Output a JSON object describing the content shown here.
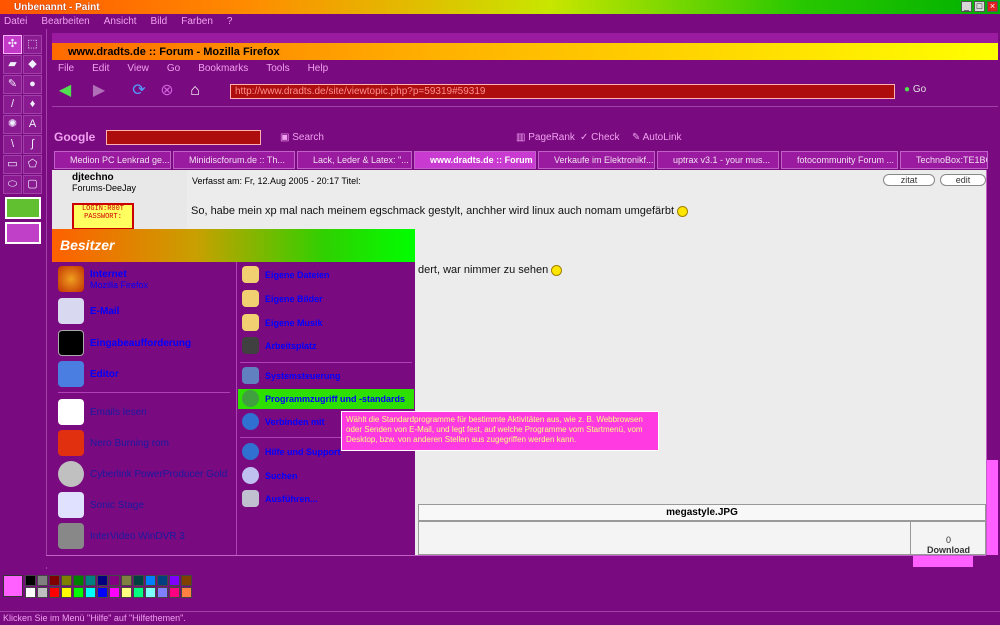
{
  "paint": {
    "title": "Unbenannt - Paint",
    "menu": [
      "Datei",
      "Bearbeiten",
      "Ansicht",
      "Bild",
      "Farben",
      "?"
    ],
    "status": "Klicken Sie im Menü \"Hilfe\" auf \"Hilfethemen\"."
  },
  "firefox": {
    "title": "www.dradts.de :: Forum - Mozilla Firefox",
    "menu": [
      "File",
      "Edit",
      "View",
      "Go",
      "Bookmarks",
      "Tools",
      "Help"
    ],
    "url": "http://www.dradts.de/site/viewtopic.php?p=59319#59319",
    "go_label": "Go",
    "google_label": "Google",
    "google_tools": [
      "Search",
      "PageRank",
      "Check",
      "AutoLink"
    ],
    "tabs": [
      "Medion PC Lenkrad ge...",
      "Minidiscforum.de :: Th...",
      "Lack, Leder & Latex: \"...",
      "www.dradts.de :: Forum",
      "Verkaufe im Elektronikf...",
      "uptrax v3.1 - your mus...",
      "fotocommunity Forum ...",
      "TechnoBox:TE1BO"
    ],
    "active_tab": 3
  },
  "forum": {
    "username": "djtechno",
    "rank": "Forums-DeeJay",
    "logo_text": "LOGIN:R00T PASSWORT:",
    "post_header": "Verfasst am: Fr, 12.Aug 2005 - 20:17    Titel:",
    "zitat": "zitat",
    "edit": "edit",
    "post_text_1": "So, habe mein xp mal nach meinem egschmack gestylt, anchher wird linux auch nomam umgefärbt",
    "post_text_2": "dert, war nimmer zu sehen",
    "attachment_title": "megastyle.JPG",
    "download_count": "0",
    "download_label": "Download"
  },
  "startmenu": {
    "user": "Besitzer",
    "left_items": [
      {
        "label": "Internet",
        "sub": "Mozilla Firefox",
        "icon": "firefox-icon",
        "color": "#e06010"
      },
      {
        "label": "E-Mail",
        "sub": "",
        "icon": "mail-icon",
        "color": "#d0d0f0"
      },
      {
        "label": "Eingabeaufforderung",
        "sub": "",
        "icon": "console-icon",
        "color": "#000000"
      },
      {
        "label": "Editor",
        "sub": "",
        "icon": "notepad-icon",
        "color": "#4080e0"
      },
      {
        "label": "Emails lesen",
        "sub": "",
        "icon": "bug-icon",
        "color": "#ffffff"
      },
      {
        "label": "Nero Burning rom",
        "sub": "",
        "icon": "nero-icon",
        "color": "#e03010"
      },
      {
        "label": "Cyberlink PowerProducer Gold",
        "sub": "",
        "icon": "disc-icon",
        "color": "#c0c0c0"
      },
      {
        "label": "Sonic Stage",
        "sub": "",
        "icon": "cubes-icon",
        "color": "#e0e0ff"
      },
      {
        "label": "InterVideo WinDVR 3",
        "sub": "",
        "icon": "dvr-icon",
        "color": "#909090"
      }
    ],
    "right_items": [
      {
        "label": "Eigene Dateien",
        "icon": "folder-icon",
        "bold": true
      },
      {
        "label": "Eigene Bilder",
        "icon": "folder-icon",
        "bold": true
      },
      {
        "label": "Eigene Musik",
        "icon": "folder-icon",
        "bold": true
      },
      {
        "label": "Arbeitsplatz",
        "icon": "computer-icon",
        "bold": true
      },
      {
        "label": "Systemsteuerung",
        "icon": "control-panel-icon",
        "bold": false
      },
      {
        "label": "Programmzugriff und -standards",
        "icon": "defaults-icon",
        "bold": false
      },
      {
        "label": "Verbinden mit",
        "icon": "globe-icon",
        "bold": false
      },
      {
        "label": "Hilfe und Support",
        "icon": "help-icon",
        "bold": false
      },
      {
        "label": "Suchen",
        "icon": "search-icon",
        "bold": false
      },
      {
        "label": "Ausführen...",
        "icon": "run-icon",
        "bold": false
      }
    ],
    "tooltip": "Wählt die Standardprogramme für bestimmte Aktivitäten aus, wie z. B. Webbrowsen oder Senden von E-Mail, und legt fest, auf welche Programme vom Startmenü, vom Desktop, bzw. von anderen Stellen aus zugegriffen werden kann."
  },
  "palette": [
    "#000000",
    "#808080",
    "#800000",
    "#808000",
    "#008000",
    "#008080",
    "#000080",
    "#800080",
    "#808040",
    "#004040",
    "#0080ff",
    "#004080",
    "#8000ff",
    "#804000",
    "#ffffff",
    "#c0c0c0",
    "#ff0000",
    "#ffff00",
    "#00ff00",
    "#00ffff",
    "#0000ff",
    "#ff00ff",
    "#ffff80",
    "#00ff80",
    "#80ffff",
    "#8080ff",
    "#ff0080",
    "#ff8040"
  ]
}
